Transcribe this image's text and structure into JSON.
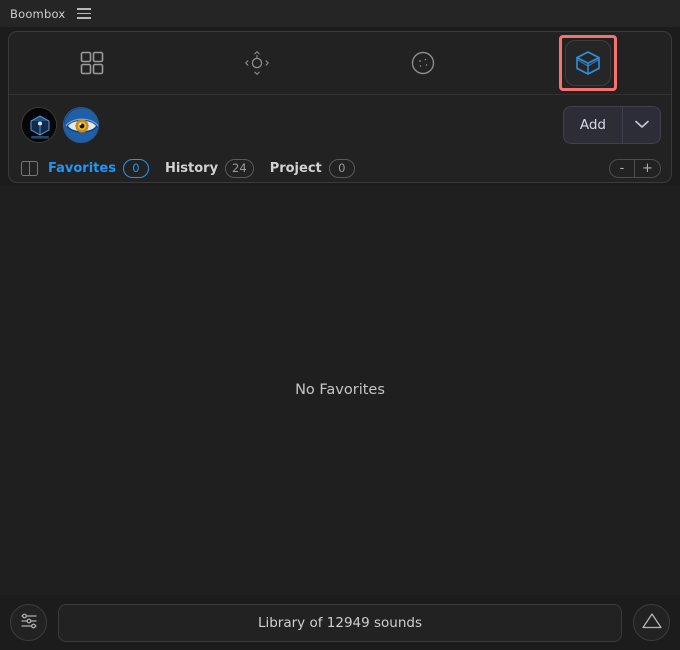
{
  "window": {
    "title": "Boombox",
    "menu_icon": "hamburger-menu-icon"
  },
  "toolbar": {
    "items": [
      {
        "name": "grid-view",
        "icon": "grid-icon",
        "selected": false
      },
      {
        "name": "move-tool",
        "icon": "move-arrows-icon",
        "selected": false
      },
      {
        "name": "sphere-tool",
        "icon": "sphere-icon",
        "selected": false
      },
      {
        "name": "package-tool",
        "icon": "cube-box-icon",
        "selected": true
      }
    ]
  },
  "avatar_row": {
    "avatars": [
      {
        "name": "boombox-logo-avatar",
        "icon": "cube-logo-icon"
      },
      {
        "name": "eye-avatar",
        "icon": "eye-icon"
      }
    ],
    "add_button": {
      "label": "Add",
      "caret_icon": "chevron-down-icon"
    }
  },
  "tabs_row": {
    "panel_toggle_icon": "sidebar-panel-icon",
    "tabs": [
      {
        "label": "Favorites",
        "badge": "0",
        "active": true
      },
      {
        "label": "History",
        "badge": "24",
        "active": false
      },
      {
        "label": "Project",
        "badge": "0",
        "active": false
      }
    ],
    "zoom_out_label": "-",
    "zoom_in_label": "+"
  },
  "content": {
    "empty_message": "No Favorites"
  },
  "footer": {
    "filter_icon": "sliders-icon",
    "search_text": "Library of 12949 sounds",
    "upload_icon": "triangle-icon"
  },
  "colors": {
    "accent_blue": "#2196f3",
    "selection_red": "#f4736f",
    "cube_blue": "#2f8fe0",
    "bg": "#1c1c1c",
    "panel_bg": "#222222"
  }
}
